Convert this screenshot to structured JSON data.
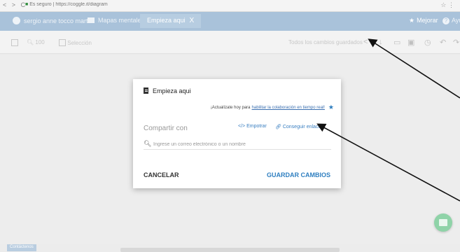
{
  "browser": {
    "url": "Es seguro | https://coggle.it/diagram",
    "nav_back": "<",
    "nav_forward": ">",
    "nav_reload": "C",
    "extensions": "☆ ⋮"
  },
  "header": {
    "user_name": "sergio anne tocco martin",
    "maps_label": "Mapas mentales",
    "active_tab": "Empieza aqui",
    "tab_close": "X",
    "upgrade_label": "Mejorar",
    "help_label": "Ayuda"
  },
  "toolbar": {
    "zoom_label": "100",
    "selection_label": "Selección",
    "saved_label": "Todos los cambios guardados"
  },
  "dialog": {
    "title": "Empieza aqui",
    "upgrade_prefix": "¡Actualízate hoy para",
    "upgrade_link": "habilitar la colaboración en tiempo real!",
    "share_label": "Compartir con",
    "embed_label": "Empotrar",
    "get_link_label": "Conseguir enlace",
    "search_placeholder": "Ingrese un correo electrónico o un nombre",
    "search_value": "",
    "cancel_label": "CANCELAR",
    "save_label": "GUARDAR CAMBIOS"
  },
  "status": {
    "contact_label": "Contáctenos"
  },
  "colors": {
    "header_bg": "#a9c2da",
    "accent_blue": "#2f7fc0",
    "fab_green": "#8fd3a8"
  }
}
